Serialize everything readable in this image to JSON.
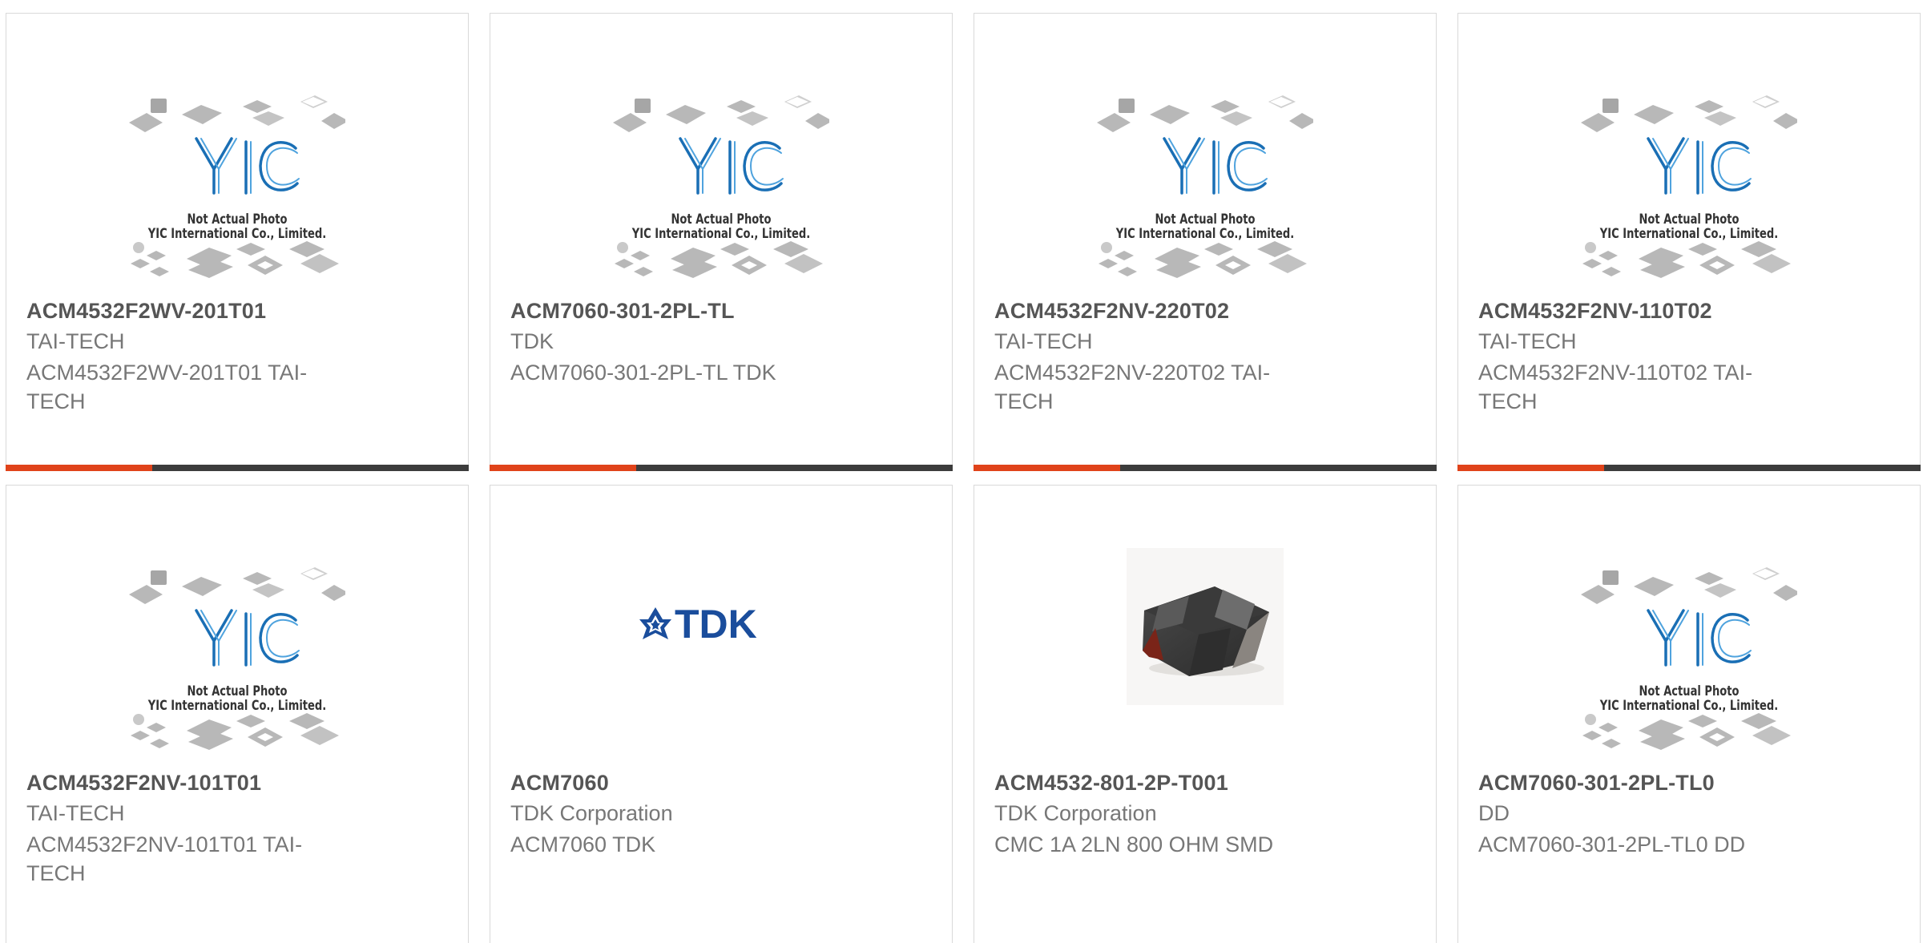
{
  "placeholder": {
    "line1": "Not Actual Photo",
    "line2": "YIC International Co., Limited.",
    "logo_text": "YIC"
  },
  "products": [
    {
      "part": "ACM4532F2WV-201T01",
      "maker": "TAI-TECH",
      "desc": "ACM4532F2WV-201T01 TAI-TECH",
      "image": "yic-placeholder"
    },
    {
      "part": "ACM7060-301-2PL-TL",
      "maker": "TDK",
      "desc": "ACM7060-301-2PL-TL TDK",
      "image": "yic-placeholder"
    },
    {
      "part": "ACM4532F2NV-220T02",
      "maker": "TAI-TECH",
      "desc": "ACM4532F2NV-220T02 TAI-TECH",
      "image": "yic-placeholder"
    },
    {
      "part": "ACM4532F2NV-110T02",
      "maker": "TAI-TECH",
      "desc": "ACM4532F2NV-110T02 TAI-TECH",
      "image": "yic-placeholder"
    },
    {
      "part": "ACM4532F2NV-101T01",
      "maker": "TAI-TECH",
      "desc": "ACM4532F2NV-101T01 TAI-TECH",
      "image": "yic-placeholder"
    },
    {
      "part": "ACM7060",
      "maker": "TDK Corporation",
      "desc": "ACM7060 TDK",
      "image": "tdk-logo",
      "logo_text": "TDK"
    },
    {
      "part": "ACM4532-801-2P-T001",
      "maker": "TDK Corporation",
      "desc": "CMC 1A 2LN 800 OHM SMD",
      "image": "chip-photo"
    },
    {
      "part": "ACM7060-301-2PL-TL0",
      "maker": "DD",
      "desc": "ACM7060-301-2PL-TL0 DD",
      "image": "yic-placeholder"
    }
  ],
  "colors": {
    "accent": "#e0431a",
    "bar": "#3c3c3c",
    "yic_blue": "#1a6fb5",
    "tdk_blue": "#1a4d9c"
  }
}
